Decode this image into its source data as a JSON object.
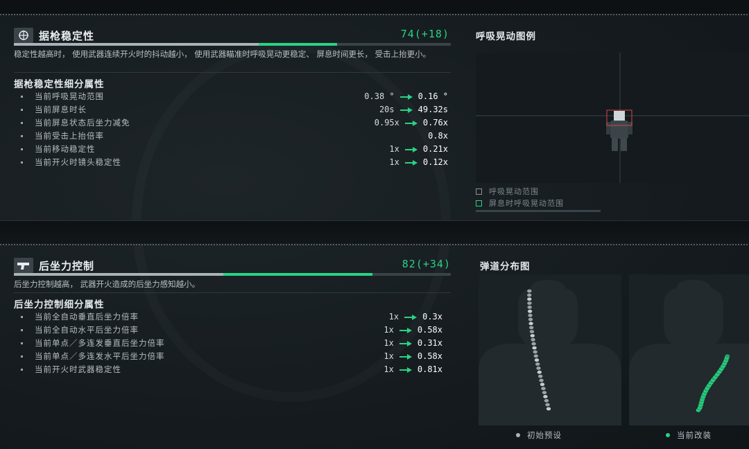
{
  "colors": {
    "accent_green": "#29d384",
    "bar_base": "#aab3b7",
    "text_main": "#e2e7ea",
    "text_dim": "#b7bfc3",
    "panel_bg": "#1b2226"
  },
  "stability": {
    "icon": "crosshair-icon",
    "title": "据枪稳定性",
    "score": "74(+18)",
    "progress": {
      "total": 100,
      "base": 56,
      "gain": 18
    },
    "description": "稳定性越高时， 使用武器连续开火时的抖动越小， 使用武器瞄准时呼吸晃动更稳定、 屏息时间更长， 受击上抬更小。",
    "sub_title": "据枪稳定性细分属性",
    "rows": [
      {
        "label": "当前呼吸晃动范围",
        "old": "0.38 °",
        "new": "0.16 °"
      },
      {
        "label": "当前屏息时长",
        "old": "20s",
        "new": "49.32s"
      },
      {
        "label": "当前屏息状态后坐力减免",
        "old": "0.95x",
        "new": "0.76x"
      },
      {
        "label": "当前受击上抬倍率",
        "old": "",
        "new": "0.8x"
      },
      {
        "label": "当前移动稳定性",
        "old": "1x",
        "new": "0.21x"
      },
      {
        "label": "当前开火时镜头稳定性",
        "old": "1x",
        "new": "0.12x"
      }
    ],
    "side_title": "呼吸晃动图例",
    "legend": [
      {
        "icon": "square-outline-icon",
        "label": "呼吸晃动范围",
        "color": "#8a9499"
      },
      {
        "icon": "square-outline-icon",
        "label": "屏息时呼吸晃动范围",
        "color": "#29d384"
      }
    ]
  },
  "recoil": {
    "icon": "pistol-icon",
    "title": "后坐力控制",
    "score": "82(+34)",
    "progress": {
      "total": 100,
      "base": 48,
      "gain": 34
    },
    "description": "后坐力控制越高， 武器开火造成的后坐力感知越小。",
    "sub_title": "后坐力控制细分属性",
    "rows": [
      {
        "label": "当前全自动垂直后坐力倍率",
        "old": "1x",
        "new": "0.3x"
      },
      {
        "label": "当前全自动水平后坐力倍率",
        "old": "1x",
        "new": "0.58x"
      },
      {
        "label": "当前单点／多连发垂直后坐力倍率",
        "old": "1x",
        "new": "0.31x"
      },
      {
        "label": "当前单点／多连发水平后坐力倍率",
        "old": "1x",
        "new": "0.58x"
      },
      {
        "label": "当前开火时武器稳定性",
        "old": "1x",
        "new": "0.81x"
      }
    ],
    "side_title": "弹道分布图",
    "legend": [
      {
        "icon": "dot-icon",
        "label": "初始预设",
        "color": "#aab3b7"
      },
      {
        "icon": "dot-icon",
        "label": "当前改装",
        "color": "#29d384"
      }
    ]
  }
}
